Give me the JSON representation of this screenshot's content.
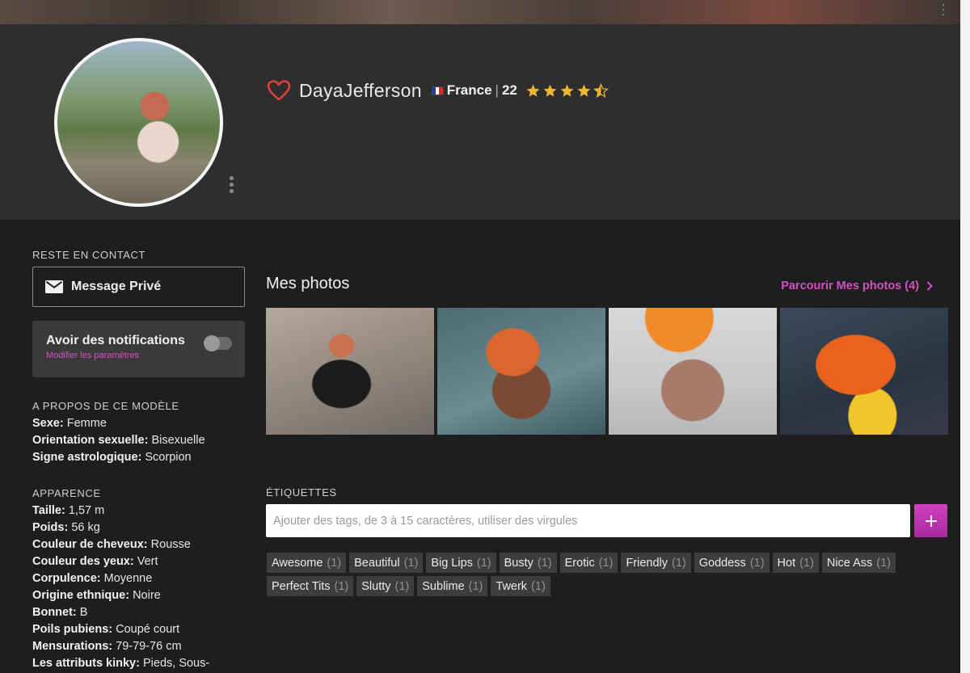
{
  "profile": {
    "username": "DayaJefferson",
    "country": "France",
    "separator": "|",
    "age": "22",
    "rating": 4.5,
    "flag_colors": [
      "#1f3fa0",
      "#ffffff",
      "#e0242f"
    ]
  },
  "contact": {
    "section_title": "RESTE EN CONTACT",
    "message_label": "Message Privé"
  },
  "notifications": {
    "title": "Avoir des notifications",
    "settings_link": "Modifier les paramètres",
    "enabled": false
  },
  "about": {
    "section_title": "A PROPOS DE CE MODÈLE",
    "items": [
      {
        "key": "Sexe:",
        "value": "Femme"
      },
      {
        "key": "Orientation sexuelle:",
        "value": "Bisexuelle"
      },
      {
        "key": "Signe astrologique:",
        "value": "Scorpion"
      }
    ]
  },
  "appearance": {
    "section_title": "APPARENCE",
    "items": [
      {
        "key": "Taille:",
        "value": "1,57 m"
      },
      {
        "key": "Poids:",
        "value": "56 kg"
      },
      {
        "key": "Couleur de cheveux:",
        "value": "Rousse"
      },
      {
        "key": "Couleur des yeux:",
        "value": "Vert"
      },
      {
        "key": "Corpulence:",
        "value": "Moyenne"
      },
      {
        "key": "Origine ethnique:",
        "value": "Noire"
      },
      {
        "key": "Bonnet:",
        "value": "B"
      },
      {
        "key": "Poils pubiens:",
        "value": "Coupé court"
      },
      {
        "key": "Mensurations:",
        "value": "79-79-76 cm"
      },
      {
        "key": "Les attributs kinky:",
        "value": "Pieds, Sous-"
      }
    ]
  },
  "photos": {
    "title": "Mes photos",
    "browse_link": "Parcourir Mes photos (4)"
  },
  "tags": {
    "section_title": "ÉTIQUETTES",
    "input_placeholder": "Ajouter des tags, de 3 à 15 caractères, utiliser des virgules",
    "items": [
      {
        "label": "Awesome",
        "count": "(1)"
      },
      {
        "label": "Beautiful",
        "count": "(1)"
      },
      {
        "label": "Big Lips",
        "count": "(1)"
      },
      {
        "label": "Busty",
        "count": "(1)"
      },
      {
        "label": "Erotic",
        "count": "(1)"
      },
      {
        "label": "Friendly",
        "count": "(1)"
      },
      {
        "label": "Goddess",
        "count": "(1)"
      },
      {
        "label": "Hot",
        "count": "(1)"
      },
      {
        "label": "Nice Ass",
        "count": "(1)"
      },
      {
        "label": "Perfect Tits",
        "count": "(1)"
      },
      {
        "label": "Slutty",
        "count": "(1)"
      },
      {
        "label": "Sublime",
        "count": "(1)"
      },
      {
        "label": "Twerk",
        "count": "(1)"
      }
    ]
  },
  "colors": {
    "accent": "#d34fc4",
    "star": "#f2b233",
    "heart": "#e0403a"
  }
}
